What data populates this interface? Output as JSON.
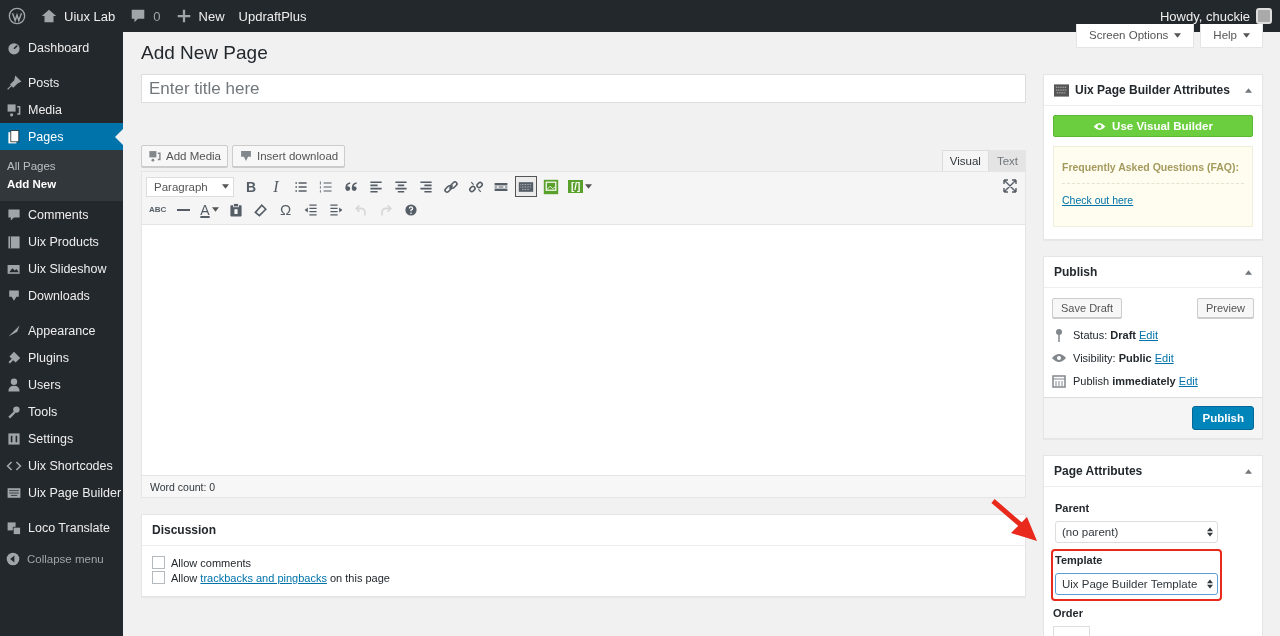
{
  "admin_bar": {
    "site": "Uiux Lab",
    "comments": "0",
    "new": "New",
    "plugin": "UpdraftPlus",
    "greeting": "Howdy, chuckie"
  },
  "sidebar": {
    "groups": [
      [
        {
          "label": "Dashboard",
          "selected": false
        }
      ],
      [
        {
          "label": "Posts",
          "selected": false
        },
        {
          "label": "Media",
          "selected": false
        },
        {
          "label": "Pages",
          "selected": true,
          "children": [
            {
              "label": "All Pages",
              "selected": false
            },
            {
              "label": "Add New",
              "selected": true
            }
          ]
        },
        {
          "label": "Comments",
          "selected": false
        },
        {
          "label": "Uix Products",
          "selected": false
        },
        {
          "label": "Uix Slideshow",
          "selected": false
        },
        {
          "label": "Downloads",
          "selected": false
        }
      ],
      [
        {
          "label": "Appearance",
          "selected": false
        },
        {
          "label": "Plugins",
          "selected": false
        },
        {
          "label": "Users",
          "selected": false
        },
        {
          "label": "Tools",
          "selected": false
        },
        {
          "label": "Settings",
          "selected": false
        },
        {
          "label": "Uix Shortcodes",
          "selected": false
        },
        {
          "label": "Uix Page Builder",
          "selected": false
        }
      ],
      [
        {
          "label": "Loco Translate",
          "selected": false
        }
      ]
    ],
    "collapse": "Collapse menu"
  },
  "screen_meta": [
    "Screen Options",
    "Help"
  ],
  "page_title": "Add New Page",
  "title_field": {
    "placeholder": "Enter title here"
  },
  "media_buttons": [
    "Add Media",
    "Insert download"
  ],
  "editor_tabs": [
    {
      "label": "Visual",
      "selected": true
    },
    {
      "label": "Text",
      "selected": false
    }
  ],
  "format_select": "Paragraph",
  "toolbar_rows": [
    [
      {
        "kind": "bold",
        "label": "B",
        "pressed": false,
        "disabled": false
      },
      {
        "kind": "italic",
        "label": "I",
        "pressed": false,
        "disabled": false
      },
      {
        "kind": "bullets",
        "pressed": false,
        "disabled": false
      },
      {
        "kind": "numbers",
        "pressed": false,
        "disabled": false
      },
      {
        "kind": "quote",
        "pressed": false,
        "disabled": false
      },
      {
        "kind": "align-left",
        "pressed": false,
        "disabled": false
      },
      {
        "kind": "align-center",
        "pressed": false,
        "disabled": false
      },
      {
        "kind": "align-right",
        "pressed": false,
        "disabled": false
      },
      {
        "kind": "link",
        "pressed": false,
        "disabled": false
      },
      {
        "kind": "unlink",
        "pressed": false,
        "disabled": false
      },
      {
        "kind": "more",
        "pressed": false,
        "disabled": false
      },
      {
        "kind": "keyboard",
        "pressed": true,
        "disabled": false
      },
      {
        "kind": "image",
        "pressed": false,
        "disabled": false
      },
      {
        "kind": "shortcode",
        "label": "[/]",
        "pressed": false,
        "disabled": false
      }
    ],
    [
      {
        "kind": "strike",
        "label": "ABC",
        "pressed": false,
        "disabled": false
      },
      {
        "kind": "rule",
        "pressed": false,
        "disabled": false
      },
      {
        "kind": "color",
        "label": "A",
        "pressed": false,
        "disabled": false
      },
      {
        "kind": "paste",
        "pressed": false,
        "disabled": false
      },
      {
        "kind": "eraser",
        "pressed": false,
        "disabled": false
      },
      {
        "kind": "symbol",
        "label": "Ω",
        "pressed": false,
        "disabled": false
      },
      {
        "kind": "outdent",
        "pressed": false,
        "disabled": false
      },
      {
        "kind": "indent",
        "pressed": false,
        "disabled": false
      },
      {
        "kind": "undo",
        "pressed": false,
        "disabled": true
      },
      {
        "kind": "redo",
        "pressed": false,
        "disabled": true
      },
      {
        "kind": "help",
        "pressed": false,
        "disabled": false
      }
    ]
  ],
  "word_count": "Word count: 0",
  "discussion": {
    "title": "Discussion",
    "options": [
      {
        "text": "Allow comments",
        "checked": false
      },
      {
        "text": "Allow ",
        "link": "trackbacks and pingbacks",
        "after": " on this page",
        "checked": false
      }
    ]
  },
  "builder_box": {
    "title": "Uix Page Builder Attributes",
    "button": "Use Visual Builder",
    "faq_title": "Frequently Asked Questions (FAQ):",
    "faq_link": "Check out here"
  },
  "publish_box": {
    "title": "Publish",
    "save": "Save Draft",
    "preview": "Preview",
    "rows": [
      {
        "text": "Status: **Draft**",
        "link": "Edit"
      },
      {
        "text": "Visibility: **Public**",
        "link": "Edit"
      },
      {
        "text": "Publish **immediately**",
        "link": "Edit"
      }
    ],
    "publish": "Publish"
  },
  "attributes_box": {
    "title": "Page Attributes",
    "fields": [
      {
        "label": "Parent",
        "value": "(no parent)",
        "highlighted": false
      },
      {
        "label": "Template",
        "value": "Uix Page Builder Template",
        "highlighted": true
      }
    ],
    "order_label": "Order"
  }
}
